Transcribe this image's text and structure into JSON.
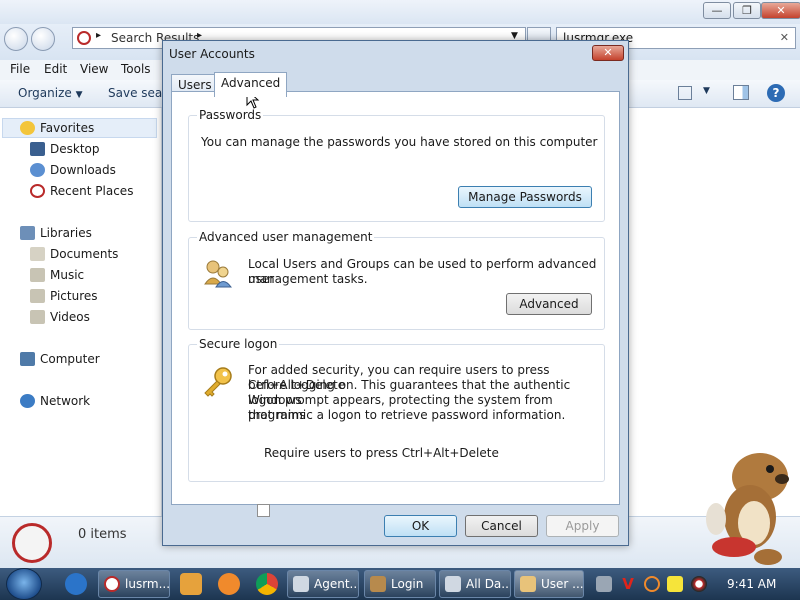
{
  "explorer": {
    "address": "Search Results",
    "search_value": "lusrmgr.exe",
    "menu": [
      "File",
      "Edit",
      "View",
      "Tools"
    ],
    "commands": {
      "organize": "Organize",
      "save_search": "Save search"
    },
    "nav": {
      "favorites": "Favorites",
      "desktop": "Desktop",
      "downloads": "Downloads",
      "recent_places": "Recent Places",
      "libraries": "Libraries",
      "documents": "Documents",
      "music": "Music",
      "pictures": "Pictures",
      "videos": "Videos",
      "computer": "Computer",
      "network": "Network"
    },
    "status": "0 items"
  },
  "dialog": {
    "title": "User Accounts",
    "close_glyph": "✕",
    "tabs": [
      "Users",
      "Advanced"
    ],
    "passwords": {
      "title": "Passwords",
      "text": "You can manage the passwords you have stored on this computer",
      "button": "Manage Passwords"
    },
    "advanced_mgmt": {
      "title": "Advanced user management",
      "text_line1": "Local Users and Groups can be used to perform advanced user",
      "text_line2": "management tasks.",
      "button": "Advanced"
    },
    "secure_logon": {
      "title": "Secure logon",
      "line1": "For added security, you can require users to press Ctrl+Alt+Delete",
      "line2": "before logging on. This guarantees that the authentic Windows",
      "line3": "logon prompt appears, protecting the system from programs",
      "line4": "that mimic a logon to retrieve password information.",
      "checkbox_label": "Require users to press Ctrl+Alt+Delete",
      "checked": false
    },
    "footer": {
      "ok": "OK",
      "cancel": "Cancel",
      "apply": "Apply"
    }
  },
  "taskbar": {
    "tasks": [
      "lusrm...",
      "Agent...",
      "Login",
      "All Da...",
      "User ..."
    ],
    "clock": "9:41 AM"
  },
  "colors": {
    "taskbar": "#2a4566",
    "dialog_frame": "#cfdceb",
    "close_red": "#c4422d"
  }
}
